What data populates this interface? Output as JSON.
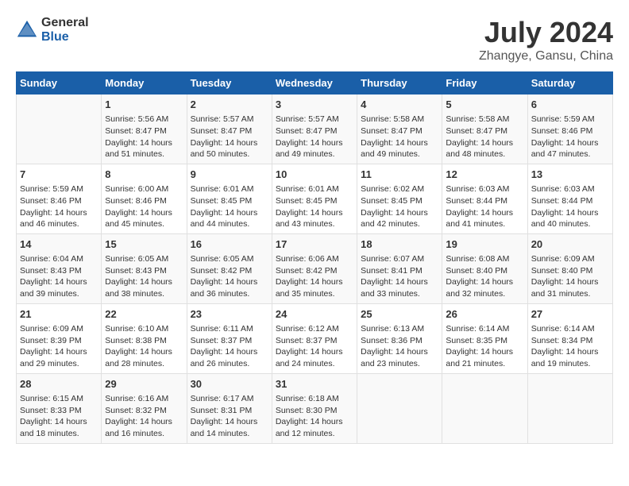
{
  "header": {
    "logo_general": "General",
    "logo_blue": "Blue",
    "title": "July 2024",
    "subtitle": "Zhangye, Gansu, China"
  },
  "calendar": {
    "days_of_week": [
      "Sunday",
      "Monday",
      "Tuesday",
      "Wednesday",
      "Thursday",
      "Friday",
      "Saturday"
    ],
    "weeks": [
      [
        {
          "day": "",
          "info": ""
        },
        {
          "day": "1",
          "info": "Sunrise: 5:56 AM\nSunset: 8:47 PM\nDaylight: 14 hours\nand 51 minutes."
        },
        {
          "day": "2",
          "info": "Sunrise: 5:57 AM\nSunset: 8:47 PM\nDaylight: 14 hours\nand 50 minutes."
        },
        {
          "day": "3",
          "info": "Sunrise: 5:57 AM\nSunset: 8:47 PM\nDaylight: 14 hours\nand 49 minutes."
        },
        {
          "day": "4",
          "info": "Sunrise: 5:58 AM\nSunset: 8:47 PM\nDaylight: 14 hours\nand 49 minutes."
        },
        {
          "day": "5",
          "info": "Sunrise: 5:58 AM\nSunset: 8:47 PM\nDaylight: 14 hours\nand 48 minutes."
        },
        {
          "day": "6",
          "info": "Sunrise: 5:59 AM\nSunset: 8:46 PM\nDaylight: 14 hours\nand 47 minutes."
        }
      ],
      [
        {
          "day": "7",
          "info": "Sunrise: 5:59 AM\nSunset: 8:46 PM\nDaylight: 14 hours\nand 46 minutes."
        },
        {
          "day": "8",
          "info": "Sunrise: 6:00 AM\nSunset: 8:46 PM\nDaylight: 14 hours\nand 45 minutes."
        },
        {
          "day": "9",
          "info": "Sunrise: 6:01 AM\nSunset: 8:45 PM\nDaylight: 14 hours\nand 44 minutes."
        },
        {
          "day": "10",
          "info": "Sunrise: 6:01 AM\nSunset: 8:45 PM\nDaylight: 14 hours\nand 43 minutes."
        },
        {
          "day": "11",
          "info": "Sunrise: 6:02 AM\nSunset: 8:45 PM\nDaylight: 14 hours\nand 42 minutes."
        },
        {
          "day": "12",
          "info": "Sunrise: 6:03 AM\nSunset: 8:44 PM\nDaylight: 14 hours\nand 41 minutes."
        },
        {
          "day": "13",
          "info": "Sunrise: 6:03 AM\nSunset: 8:44 PM\nDaylight: 14 hours\nand 40 minutes."
        }
      ],
      [
        {
          "day": "14",
          "info": "Sunrise: 6:04 AM\nSunset: 8:43 PM\nDaylight: 14 hours\nand 39 minutes."
        },
        {
          "day": "15",
          "info": "Sunrise: 6:05 AM\nSunset: 8:43 PM\nDaylight: 14 hours\nand 38 minutes."
        },
        {
          "day": "16",
          "info": "Sunrise: 6:05 AM\nSunset: 8:42 PM\nDaylight: 14 hours\nand 36 minutes."
        },
        {
          "day": "17",
          "info": "Sunrise: 6:06 AM\nSunset: 8:42 PM\nDaylight: 14 hours\nand 35 minutes."
        },
        {
          "day": "18",
          "info": "Sunrise: 6:07 AM\nSunset: 8:41 PM\nDaylight: 14 hours\nand 33 minutes."
        },
        {
          "day": "19",
          "info": "Sunrise: 6:08 AM\nSunset: 8:40 PM\nDaylight: 14 hours\nand 32 minutes."
        },
        {
          "day": "20",
          "info": "Sunrise: 6:09 AM\nSunset: 8:40 PM\nDaylight: 14 hours\nand 31 minutes."
        }
      ],
      [
        {
          "day": "21",
          "info": "Sunrise: 6:09 AM\nSunset: 8:39 PM\nDaylight: 14 hours\nand 29 minutes."
        },
        {
          "day": "22",
          "info": "Sunrise: 6:10 AM\nSunset: 8:38 PM\nDaylight: 14 hours\nand 28 minutes."
        },
        {
          "day": "23",
          "info": "Sunrise: 6:11 AM\nSunset: 8:37 PM\nDaylight: 14 hours\nand 26 minutes."
        },
        {
          "day": "24",
          "info": "Sunrise: 6:12 AM\nSunset: 8:37 PM\nDaylight: 14 hours\nand 24 minutes."
        },
        {
          "day": "25",
          "info": "Sunrise: 6:13 AM\nSunset: 8:36 PM\nDaylight: 14 hours\nand 23 minutes."
        },
        {
          "day": "26",
          "info": "Sunrise: 6:14 AM\nSunset: 8:35 PM\nDaylight: 14 hours\nand 21 minutes."
        },
        {
          "day": "27",
          "info": "Sunrise: 6:14 AM\nSunset: 8:34 PM\nDaylight: 14 hours\nand 19 minutes."
        }
      ],
      [
        {
          "day": "28",
          "info": "Sunrise: 6:15 AM\nSunset: 8:33 PM\nDaylight: 14 hours\nand 18 minutes."
        },
        {
          "day": "29",
          "info": "Sunrise: 6:16 AM\nSunset: 8:32 PM\nDaylight: 14 hours\nand 16 minutes."
        },
        {
          "day": "30",
          "info": "Sunrise: 6:17 AM\nSunset: 8:31 PM\nDaylight: 14 hours\nand 14 minutes."
        },
        {
          "day": "31",
          "info": "Sunrise: 6:18 AM\nSunset: 8:30 PM\nDaylight: 14 hours\nand 12 minutes."
        },
        {
          "day": "",
          "info": ""
        },
        {
          "day": "",
          "info": ""
        },
        {
          "day": "",
          "info": ""
        }
      ]
    ]
  }
}
